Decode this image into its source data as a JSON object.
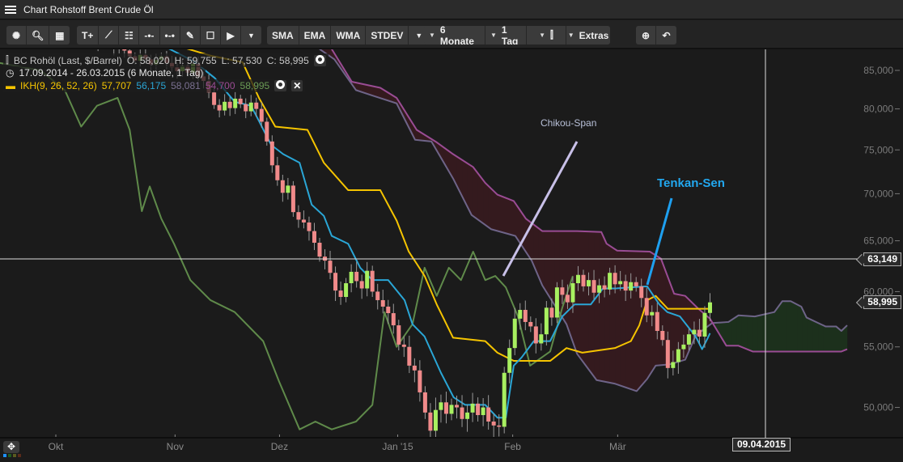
{
  "window": {
    "title": "Chart Rohstoff Brent Crude Öl"
  },
  "toolbar": {
    "view_tools": [
      "settings-icon",
      "zoom-icon",
      "layout-grid-icon"
    ],
    "draw_tools": [
      "T+",
      "line",
      "fibonacci",
      "horizontal-line",
      "horizontal-ray",
      "pencil",
      "rectangle",
      "arrow"
    ],
    "indicators": [
      "SMA",
      "EMA",
      "WMA",
      "STDEV"
    ],
    "period": "6 Monate",
    "interval": "1 Tag",
    "extras": "Extras"
  },
  "legend": {
    "instrument": "BC Rohöl (Last, $/Barrel)",
    "open": "O: 58,020",
    "high": "H: 59,755",
    "low": "L: 57,530",
    "close": "C: 58,995",
    "range": "17.09.2014 - 26.03.2015 (6 Monate, 1 Tag)",
    "indicator": "IKH(9, 26, 52, 26)",
    "values": [
      "57,707",
      "56,175",
      "58,081",
      "54,700",
      "58,995"
    ]
  },
  "annotations": {
    "chikou": "Chikou-Span",
    "tenkan": "Tenkan-Sen"
  },
  "crosshair": {
    "price": "63,149",
    "date": "09.04.2015"
  },
  "last_price": "58,995",
  "colors": {
    "up": "#a8f060",
    "down": "#f08a8a",
    "tenkan": "#2aa6d6",
    "kijun": "#f5c400",
    "chikou": "#5f8a4a",
    "senkou_a": "#6e6488",
    "senkou_b": "#9a4c94",
    "cloud_bear": "#341a1e",
    "cloud_bull": "#1c301c"
  },
  "chart_data": {
    "type": "candlestick",
    "title": "Chart Rohstoff Brent Crude Öl",
    "ylim": [
      47,
      88
    ],
    "yscale": "log",
    "yticks": [
      {
        "v": 50,
        "label": "50,000"
      },
      {
        "v": 55,
        "label": "55,000"
      },
      {
        "v": 60,
        "label": "60,000"
      },
      {
        "v": 65,
        "label": "65,000"
      },
      {
        "v": 70,
        "label": "70,000"
      },
      {
        "v": 75,
        "label": "75,000"
      },
      {
        "v": 80,
        "label": "80,000"
      },
      {
        "v": 85,
        "label": "85,000"
      }
    ],
    "xticks": [
      {
        "i": 0,
        "label": "Okt"
      },
      {
        "i": 22.6,
        "label": "Nov"
      },
      {
        "i": 42.4,
        "label": "Dez"
      },
      {
        "i": 64.8,
        "label": "Jan '15"
      },
      {
        "i": 86.6,
        "label": "Feb"
      },
      {
        "i": 106.5,
        "label": "Mär"
      }
    ],
    "x_unit": "trading day index (0 = 01.10.2014)",
    "first_index": -10,
    "closes": [
      98.5,
      97.8,
      97.2,
      97.6,
      96.9,
      96.0,
      95.3,
      95.9,
      94.7,
      94.2,
      93.8,
      93.1,
      92.3,
      91.5,
      92.0,
      90.6,
      90.1,
      89.2,
      88.6,
      89.1,
      88.4,
      87.9,
      88.6,
      87.7,
      86.9,
      86.3,
      87.1,
      86.5,
      85.8,
      86.4,
      86.9,
      86.0,
      85.4,
      84.9,
      85.6,
      84.7,
      85.9,
      84.2,
      83.6,
      82.1,
      80.5,
      79.8,
      80.9,
      80.1,
      81.3,
      80.6,
      79.7,
      80.8,
      80.0,
      78.4,
      76.0,
      73.2,
      71.5,
      70.1,
      70.9,
      68.0,
      67.2,
      66.9,
      66.0,
      64.8,
      63.4,
      63.0,
      61.8,
      60.1,
      59.5,
      60.8,
      61.9,
      61.0,
      60.3,
      62.0,
      60.0,
      59.2,
      58.6,
      58.0,
      56.9,
      55.2,
      55.0,
      53.4,
      53.0,
      51.2,
      49.6,
      48.2,
      49.8,
      50.4,
      49.5,
      50.2,
      50.0,
      49.1,
      49.6,
      50.3,
      49.4,
      50.0,
      48.9,
      48.6,
      48.5,
      52.8,
      54.9,
      57.5,
      58.3,
      57.2,
      56.8,
      55.3,
      56.1,
      58.5,
      57.6,
      60.4,
      59.7,
      59.0,
      60.8,
      61.6,
      60.5,
      61.1,
      59.9,
      60.6,
      60.2,
      61.8,
      60.7,
      61.0,
      60.1,
      60.9,
      60.5,
      59.4,
      57.8,
      58.1,
      56.4,
      55.6,
      53.2,
      53.7,
      54.8,
      55.2,
      56.1,
      56.5,
      55.9,
      58.02,
      58.995
    ],
    "series": [
      {
        "name": "Chikou-Span",
        "key": "chikou",
        "points": [
          [
            -10.6,
            86
          ],
          [
            -2.9,
            85
          ],
          [
            1.7,
            82.4
          ],
          [
            4.8,
            77.8
          ],
          [
            7.8,
            80.4
          ],
          [
            11.7,
            81.4
          ],
          [
            14,
            77.4
          ],
          [
            16.3,
            68.1
          ],
          [
            17.8,
            70.8
          ],
          [
            20,
            67.3
          ],
          [
            22.4,
            64.7
          ],
          [
            25.5,
            61.1
          ],
          [
            29.3,
            59.2
          ],
          [
            33.9,
            58.1
          ],
          [
            39.3,
            55.5
          ],
          [
            42.3,
            52.1
          ],
          [
            46.2,
            48.3
          ],
          [
            49.2,
            48.9
          ],
          [
            52.3,
            48.3
          ],
          [
            56.9,
            48.9
          ],
          [
            60,
            50.2
          ],
          [
            62.3,
            58.1
          ],
          [
            64.6,
            55.0
          ],
          [
            67.6,
            57.0
          ],
          [
            69.9,
            62.3
          ],
          [
            72.2,
            59.6
          ],
          [
            74.5,
            62.3
          ],
          [
            76.8,
            61.1
          ],
          [
            79.1,
            63.9
          ],
          [
            81.4,
            61.1
          ],
          [
            83.3,
            61.5
          ],
          [
            85.3,
            60.4
          ],
          [
            87.6,
            57.7
          ],
          [
            89.9,
            53.4
          ],
          [
            93.7,
            54.6
          ],
          [
            96,
            58.5
          ],
          [
            98,
            61.5
          ]
        ]
      },
      {
        "name": "Tenkan-Sen",
        "key": "tenkan",
        "points": [
          [
            12.4,
            89
          ],
          [
            20,
            88.5
          ],
          [
            26.2,
            86.2
          ],
          [
            30.1,
            84
          ],
          [
            33.9,
            80.9
          ],
          [
            37,
            80.4
          ],
          [
            38.5,
            78.5
          ],
          [
            40.8,
            75.6
          ],
          [
            43.1,
            74.5
          ],
          [
            46.2,
            73.5
          ],
          [
            48.5,
            68.8
          ],
          [
            50.8,
            67.6
          ],
          [
            52.3,
            65.5
          ],
          [
            55.4,
            64.7
          ],
          [
            57.7,
            62.3
          ],
          [
            60,
            61.1
          ],
          [
            63,
            61.1
          ],
          [
            66.1,
            59.2
          ],
          [
            67.6,
            57.0
          ],
          [
            69.9,
            55.9
          ],
          [
            73,
            52.8
          ],
          [
            75.4,
            50.8
          ],
          [
            77.6,
            50.2
          ],
          [
            81.4,
            50.2
          ],
          [
            83.7,
            49.2
          ],
          [
            85.3,
            49.2
          ],
          [
            86.8,
            53.4
          ],
          [
            88.3,
            54.1
          ],
          [
            90.6,
            55.5
          ],
          [
            93.7,
            55.5
          ],
          [
            96,
            57.7
          ],
          [
            98.3,
            58.8
          ],
          [
            101.4,
            58.8
          ],
          [
            103.7,
            60.3
          ],
          [
            106,
            60.3
          ],
          [
            112.1,
            60.5
          ],
          [
            114.4,
            58.8
          ],
          [
            115.9,
            58.1
          ],
          [
            118.3,
            57.7
          ],
          [
            121.3,
            55.9
          ],
          [
            122.5,
            54.8
          ],
          [
            123.6,
            55.8
          ],
          [
            124,
            56.2
          ]
        ]
      },
      {
        "name": "Kijun-Sen",
        "key": "kijun",
        "points": [
          [
            24.7,
            88
          ],
          [
            29.3,
            87
          ],
          [
            35.4,
            86.1
          ],
          [
            38.5,
            81.4
          ],
          [
            41.6,
            77.8
          ],
          [
            47.7,
            77.4
          ],
          [
            50.8,
            73.5
          ],
          [
            55.4,
            70.4
          ],
          [
            61.5,
            70.4
          ],
          [
            64.6,
            67.1
          ],
          [
            66.9,
            63.9
          ],
          [
            68.4,
            62.7
          ],
          [
            69.9,
            61.5
          ],
          [
            72.2,
            58.8
          ],
          [
            75.3,
            55.8
          ],
          [
            81.4,
            55.5
          ],
          [
            83.7,
            54.5
          ],
          [
            86.8,
            53.8
          ],
          [
            93.7,
            53.8
          ],
          [
            96.8,
            54.9
          ],
          [
            99.8,
            54.5
          ],
          [
            106,
            54.9
          ],
          [
            109,
            55.5
          ],
          [
            110.6,
            56.9
          ],
          [
            112.1,
            59.2
          ],
          [
            113.7,
            59.6
          ],
          [
            116,
            58.4
          ],
          [
            124.1,
            58.4
          ]
        ]
      },
      {
        "name": "Senkou-Span A",
        "key": "senkou_a",
        "points": [
          [
            50,
            87.9
          ],
          [
            52.8,
            86.5
          ],
          [
            56.9,
            82.4
          ],
          [
            60,
            81.7
          ],
          [
            64.6,
            80.7
          ],
          [
            68.1,
            76.2
          ],
          [
            71.2,
            76.0
          ],
          [
            75.3,
            71.7
          ],
          [
            78.8,
            67.7
          ],
          [
            82.5,
            66.2
          ],
          [
            87.1,
            65.5
          ],
          [
            90.2,
            63.0
          ],
          [
            92.2,
            60.6
          ],
          [
            96.8,
            57.0
          ],
          [
            98.8,
            54.4
          ],
          [
            102.5,
            52.2
          ],
          [
            106,
            51.9
          ],
          [
            110.1,
            51.3
          ],
          [
            112.1,
            52.3
          ],
          [
            113.7,
            53.4
          ],
          [
            116.3,
            53.5
          ],
          [
            119.3,
            53.9
          ],
          [
            121.3,
            56.0
          ],
          [
            124.4,
            57.1
          ],
          [
            127.5,
            57.2
          ],
          [
            129.4,
            57.8
          ],
          [
            132.5,
            57.7
          ],
          [
            136.2,
            58.1
          ],
          [
            137.7,
            59.1
          ],
          [
            139.3,
            59.1
          ],
          [
            141.3,
            58.6
          ],
          [
            142.3,
            57.6
          ],
          [
            145.9,
            56.8
          ],
          [
            147.9,
            56.8
          ],
          [
            148.9,
            56.4
          ],
          [
            150,
            56.9
          ]
        ]
      },
      {
        "name": "Senkou-Span B",
        "key": "senkou_b",
        "points": [
          [
            50,
            89.5
          ],
          [
            52.3,
            87.9
          ],
          [
            56.1,
            83.5
          ],
          [
            61.5,
            82.7
          ],
          [
            64.6,
            81.4
          ],
          [
            68.4,
            77.4
          ],
          [
            72.2,
            75.9
          ],
          [
            75.3,
            74.5
          ],
          [
            79.1,
            73.0
          ],
          [
            81.4,
            71.2
          ],
          [
            83.7,
            69.9
          ],
          [
            86.8,
            69.2
          ],
          [
            89.1,
            67.3
          ],
          [
            92.2,
            66.0
          ],
          [
            98.8,
            66.0
          ],
          [
            103.4,
            65.9
          ],
          [
            104.4,
            64.7
          ],
          [
            106.4,
            64.0
          ],
          [
            112.6,
            63.9
          ],
          [
            114.7,
            63.2
          ],
          [
            117.2,
            59.8
          ],
          [
            119.3,
            59.6
          ],
          [
            121.8,
            58.4
          ],
          [
            124,
            57.5
          ],
          [
            127.1,
            55.1
          ],
          [
            129.4,
            55.1
          ],
          [
            132.1,
            54.6
          ],
          [
            148.9,
            54.6
          ],
          [
            150,
            54.8
          ]
        ]
      }
    ]
  }
}
